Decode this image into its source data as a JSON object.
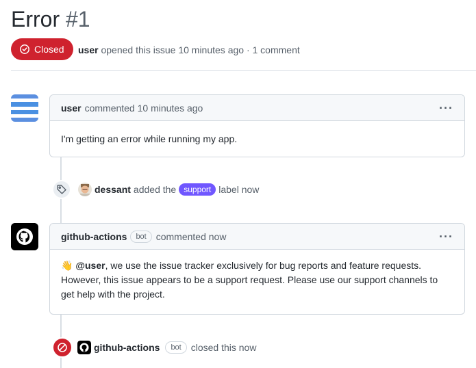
{
  "issue": {
    "title": "Error",
    "number": "#1",
    "state_label": "Closed",
    "author": "user",
    "meta_text": "opened this issue 10 minutes ago · 1 comment",
    "state_color": "#cf222e"
  },
  "comments": [
    {
      "author": "user",
      "bot_badge": "",
      "action": "commented 10 minutes ago",
      "body": "I'm getting an error while running my app."
    },
    {
      "author": "github-actions",
      "bot_badge": "bot",
      "action": "commented now",
      "body_emoji": "👋",
      "body_mention": "@user",
      "body_text": ", we use the issue tracker exclusively for bug reports and feature requests. However, this issue appears to be a support request. Please use our support channels to get help with the project."
    }
  ],
  "events": [
    {
      "icon": "tag-icon",
      "actor": "dessant",
      "text_before": "added the",
      "label": "support",
      "label_color": "#7057ff",
      "text_after": "label now"
    },
    {
      "icon": "closed-icon",
      "actor": "github-actions",
      "bot_badge": "bot",
      "text": "closed this now",
      "badge_color": "#cf222e"
    }
  ],
  "menu_glyph": "···"
}
